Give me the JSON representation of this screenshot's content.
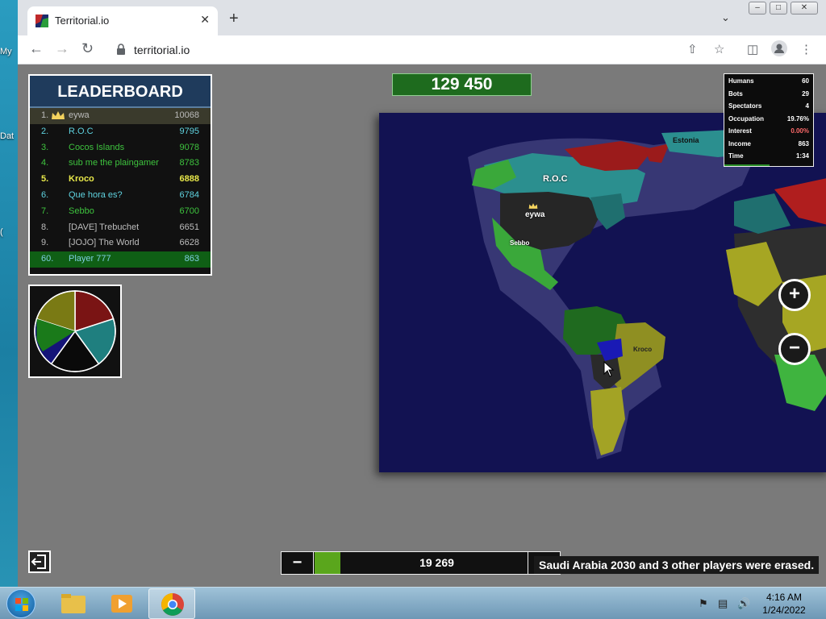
{
  "desktop": {
    "icons": [
      {
        "label": "My"
      },
      {
        "label": "Dat"
      },
      {
        "label": "("
      }
    ]
  },
  "browser": {
    "tab_title": "Territorial.io",
    "url": "territorial.io",
    "new_tab": "+",
    "tab_close": "✕"
  },
  "game": {
    "balance": "129 450",
    "leaderboard": {
      "title": "LEADERBOARD",
      "rows": [
        {
          "rank": "1.",
          "name": "eywa",
          "score": "10068"
        },
        {
          "rank": "2.",
          "name": "R.O.C",
          "score": "9795"
        },
        {
          "rank": "3.",
          "name": "Cocos Islands",
          "score": "9078"
        },
        {
          "rank": "4.",
          "name": "sub me the plaingamer",
          "score": "8783"
        },
        {
          "rank": "5.",
          "name": "Kroco",
          "score": "6888"
        },
        {
          "rank": "6.",
          "name": "Que hora es?",
          "score": "6784"
        },
        {
          "rank": "7.",
          "name": "Sebbo",
          "score": "6700"
        },
        {
          "rank": "8.",
          "name": "[DAVE] Trebuchet",
          "score": "6651"
        },
        {
          "rank": "9.",
          "name": "[JOJO] The World",
          "score": "6628"
        }
      ],
      "me": {
        "rank": "60.",
        "name": "Player 777",
        "score": "863"
      }
    },
    "stats": [
      {
        "label": "Humans",
        "value": "60"
      },
      {
        "label": "Bots",
        "value": "29"
      },
      {
        "label": "Spectators",
        "value": "4"
      },
      {
        "label": "Occupation",
        "value": "19.76%"
      },
      {
        "label": "Interest",
        "value": "0.00%"
      },
      {
        "label": "Income",
        "value": "863"
      },
      {
        "label": "Time",
        "value": "1:34"
      }
    ],
    "map_labels": {
      "roc": "R.O.C",
      "eywa": "eywa",
      "sebbo": "Sebbo",
      "kroco": "Kroco",
      "estonia": "Estonia"
    },
    "troops": {
      "minus": "−",
      "plus": "+",
      "value": "19 269",
      "fraction": 0.12
    },
    "message": "Saudi Arabia 2030 and 3 other players were erased.",
    "zoom_in": "+",
    "zoom_out": "−",
    "colors": {
      "ocean": "#121252",
      "lb_header": "#1f3b5c",
      "balance_bg": "#1e6b1e"
    }
  },
  "taskbar": {
    "time": "4:16 AM",
    "date": "1/24/2022"
  }
}
